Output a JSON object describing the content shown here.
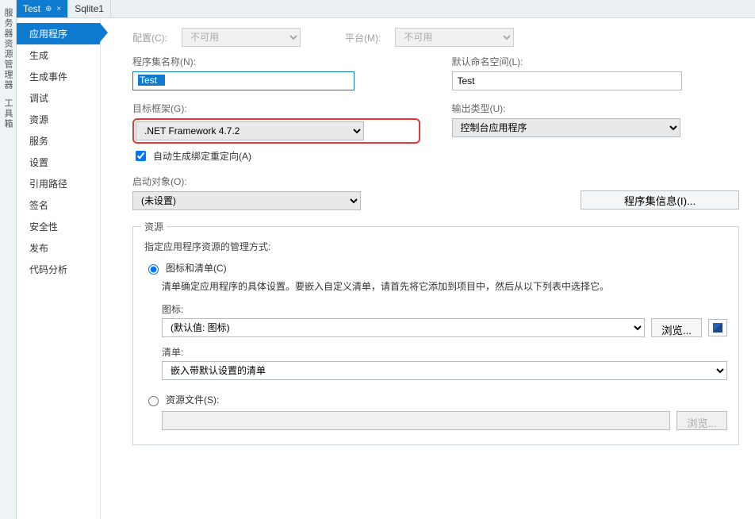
{
  "leftRail": {
    "item1": "服务器资源管理器",
    "item2": "工具箱"
  },
  "tabs": {
    "active": {
      "title": "Test",
      "pin": "⊕",
      "close": "×"
    },
    "other": {
      "title": "Sqlite1"
    }
  },
  "sidebar": {
    "items": [
      "应用程序",
      "生成",
      "生成事件",
      "调试",
      "资源",
      "服务",
      "设置",
      "引用路径",
      "签名",
      "安全性",
      "发布",
      "代码分析"
    ]
  },
  "topRow": {
    "configLabel": "配置(C):",
    "configValue": "不可用",
    "platformLabel": "平台(M):",
    "platformValue": "不可用"
  },
  "assembly": {
    "nameLabel": "程序集名称(N):",
    "nameValue": "Test",
    "nsLabel": "默认命名空间(L):",
    "nsValue": "Test"
  },
  "target": {
    "frameworkLabel": "目标框架(G):",
    "frameworkValue": ".NET Framework 4.7.2",
    "outputLabel": "输出类型(U):",
    "outputValue": "控制台应用程序"
  },
  "autoBinding": "自动生成绑定重定向(A)",
  "startup": {
    "label": "启动对象(O):",
    "value": "(未设置)",
    "asmInfoBtn": "程序集信息(I)..."
  },
  "resources": {
    "groupTitle": "资源",
    "desc": "指定应用程序资源的管理方式:",
    "radioIconManifest": "图标和清单(C)",
    "manifestDesc": "清单确定应用程序的具体设置。要嵌入自定义清单，请首先将它添加到项目中，然后从以下列表中选择它。",
    "iconLabel": "图标:",
    "iconValue": "(默认值: 图标)",
    "browse": "浏览...",
    "manifestLabel": "清单:",
    "manifestValue": "嵌入带默认设置的清单",
    "radioResFile": "资源文件(S):",
    "resFileValue": ""
  }
}
